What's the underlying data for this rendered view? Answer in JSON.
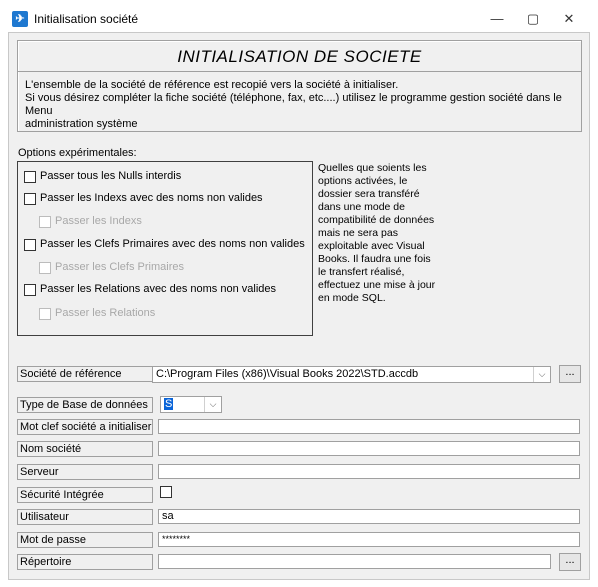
{
  "window": {
    "title": "Initialisation société",
    "icon": "app-icon",
    "minimize_glyph": "—",
    "maximize_glyph": "▢",
    "close_glyph": "✕"
  },
  "header": {
    "title": "INITIALISATION DE SOCIETE",
    "line1": "L'ensemble de la société de référence est recopié vers la société à initialiser.",
    "line2": "Si vous désirez compléter la fiche société (téléphone, fax, etc....) utilisez le programme gestion société dans le Menu",
    "line3": "administration système"
  },
  "options": {
    "label": "Options expérimentales:",
    "items": [
      {
        "label": "Passer tous les Nulls interdis",
        "checked": false,
        "enabled": true
      },
      {
        "label": "Passer les Indexs avec des noms non valides",
        "checked": false,
        "enabled": true
      },
      {
        "label": "Passer les Indexs",
        "checked": false,
        "enabled": false
      },
      {
        "label": "Passer les Clefs Primaires avec des noms non valides",
        "checked": false,
        "enabled": true
      },
      {
        "label": "Passer les Clefs Primaires",
        "checked": false,
        "enabled": false
      },
      {
        "label": "Passer les Relations avec des noms non valides",
        "checked": false,
        "enabled": true
      },
      {
        "label": "Passer les Relations",
        "checked": false,
        "enabled": false
      }
    ],
    "info_lines": [
      "Quelles que soients les",
      "options activées, le",
      "dossier sera transféré",
      "dans une mode de",
      "compatibilité de données",
      "mais ne sera pas",
      "exploitable avec Visual",
      "Books.  Il faudra une fois",
      "le transfert réalisé,",
      "effectuez une mise à jour",
      "en mode SQL."
    ]
  },
  "form": {
    "reference": {
      "label": "Société de référence",
      "value": "C:\\Program Files (x86)\\Visual Books 2022\\STD.accdb",
      "browse": "..."
    },
    "db_type": {
      "label": "Type de Base de données",
      "value": "S"
    },
    "key": {
      "label": "Mot clef société a initialiser",
      "value": ""
    },
    "company_name": {
      "label": "Nom société",
      "value": ""
    },
    "server": {
      "label": "Serveur",
      "value": ""
    },
    "integrated_security": {
      "label": "Sécurité Intégrée",
      "checked": false
    },
    "user": {
      "label": "Utilisateur",
      "value": "sa"
    },
    "password": {
      "label": "Mot de passe",
      "value": "********"
    },
    "directory": {
      "label": "Répertoire",
      "value": "",
      "browse": "..."
    }
  }
}
